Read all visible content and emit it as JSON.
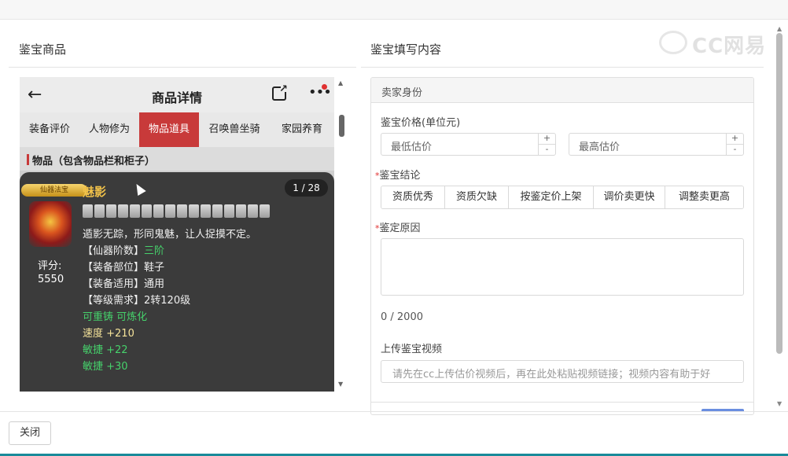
{
  "left_panel": {
    "title": "鉴宝商品"
  },
  "right_panel": {
    "title": "鉴宝填写内容"
  },
  "phone": {
    "back_icon": "←",
    "title": "商品详情",
    "share_icon": "external-link-icon",
    "more_icon": "•••",
    "tabs": [
      {
        "label": "装备评价",
        "active": false
      },
      {
        "label": "人物修为",
        "active": false
      },
      {
        "label": "物品道具",
        "active": true
      },
      {
        "label": "召唤兽坐骑",
        "active": false
      },
      {
        "label": "家园养育",
        "active": false
      }
    ],
    "section_label": "物品（包含物品栏和柜子）",
    "item": {
      "badge": "仙器法宝",
      "name": "魅影",
      "counter": "1 / 28",
      "gem_count": 16,
      "score_label": "评分:",
      "score_value": "5550",
      "description": "遁影无踪，形同鬼魅，让人捉摸不定。",
      "attrs": [
        {
          "key": "【仙器阶数】",
          "value": "三阶",
          "value_color": "green"
        },
        {
          "key": "【装备部位】",
          "value": "鞋子",
          "value_color": ""
        },
        {
          "key": "【装备适用】",
          "value": "通用",
          "value_color": ""
        },
        {
          "key": "【等级需求】",
          "value": "2转120级",
          "value_color": ""
        }
      ],
      "recast": "可重铸 可炼化",
      "stats": [
        {
          "text": "速度 +210",
          "color": "yellow"
        },
        {
          "text": "敏捷 +22",
          "color": "green"
        },
        {
          "text": "敏捷 +30",
          "color": "green"
        }
      ]
    }
  },
  "form": {
    "section_head": "卖家身份",
    "price_label": "鉴宝价格(单位元)",
    "min_placeholder": "最低估价",
    "max_placeholder": "最高估价",
    "stepper_plus": "+",
    "stepper_minus": "-",
    "conclusion_label": "鉴宝结论",
    "conclusion_options": [
      "资质优秀",
      "资质欠缺",
      "按鉴定价上架",
      "调价卖更快",
      "调整卖更高"
    ],
    "reason_label": "鉴定原因",
    "reason_count": "0 / 2000",
    "video_label": "上传鉴宝视频",
    "video_placeholder": "请先在cc上传估价视频后，再在此处粘贴视频链接；视频内容有助于好"
  },
  "watermark": "CC网易",
  "footer": {
    "close_label": "关闭"
  },
  "colors": {
    "accent_red": "#c83a3a",
    "green": "#46d16b",
    "gold": "#f2c24a"
  }
}
